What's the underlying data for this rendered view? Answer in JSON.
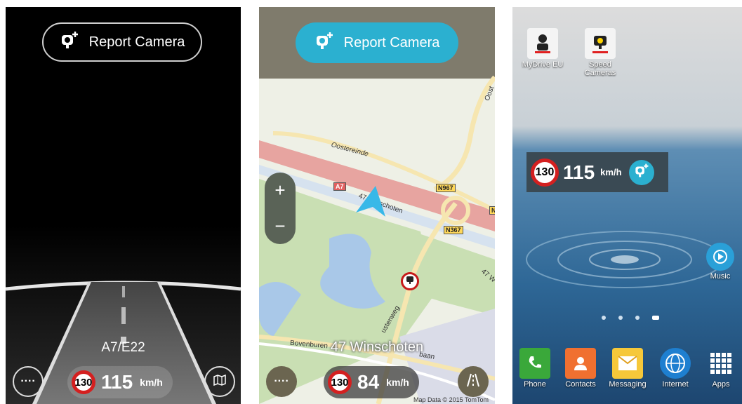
{
  "panel1": {
    "report_button": "Report Camera",
    "road_name": "A7/E22",
    "speed_limit": "130",
    "speed": "115",
    "unit": "km/h",
    "more_icon": "more-dots-icon",
    "map_icon": "map-icon"
  },
  "panel2": {
    "report_button": "Report Camera",
    "zoom_in": "+",
    "zoom_out": "−",
    "street_label": "47 Winschoten",
    "speed_limit": "130",
    "speed": "84",
    "unit": "km/h",
    "attribution": "Map Data © 2015 TomTom",
    "labels": {
      "oostereinde": "Oostereinde",
      "bovenburen": "Bovenburen",
      "a7": "A7",
      "n967": "N967",
      "n367": "N367",
      "winschoten_small": "47 Winschoten",
      "w47": "47 W",
      "oost": "Oost",
      "n": "N",
      "ustenweg": "ustenweg",
      "baan": "baan"
    }
  },
  "panel3": {
    "apps_top": [
      {
        "label": "MyDrive EU",
        "icon": "tomtom-mydrive-icon"
      },
      {
        "label": "Speed Cameras",
        "icon": "tomtom-speedcam-icon"
      }
    ],
    "widget": {
      "speed_limit": "130",
      "speed": "115",
      "unit": "km/h"
    },
    "music_label": "Music",
    "dock": [
      {
        "label": "Phone",
        "icon": "phone-icon"
      },
      {
        "label": "Contacts",
        "icon": "contacts-icon"
      },
      {
        "label": "Messaging",
        "icon": "messaging-icon"
      },
      {
        "label": "Internet",
        "icon": "globe-icon"
      },
      {
        "label": "Apps",
        "icon": "apps-grid-icon"
      }
    ]
  },
  "colors": {
    "teal": "#2bb0d0",
    "speed_red": "#d42020",
    "map_green": "#c9dfb3",
    "water_blue": "#a9c8e8",
    "motorway_pink": "#e7a4a0"
  }
}
